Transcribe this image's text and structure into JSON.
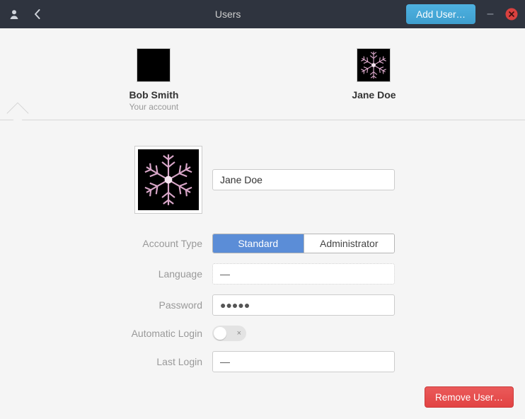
{
  "header": {
    "title": "Users",
    "add_label": "Add User…"
  },
  "users": [
    {
      "name": "Bob Smith",
      "subtitle": "Your account"
    },
    {
      "name": "Jane Doe"
    }
  ],
  "labels": {
    "account_type": "Account Type",
    "language": "Language",
    "password": "Password",
    "automatic_login": "Automatic Login",
    "last_login": "Last Login"
  },
  "detail": {
    "name": "Jane Doe",
    "account_type": {
      "selected": "Standard",
      "options": [
        "Standard",
        "Administrator"
      ]
    },
    "language": "—",
    "password": "●●●●●",
    "automatic_login": false,
    "last_login": "—"
  },
  "footer": {
    "remove_label": "Remove User…"
  },
  "colors": {
    "titlebar": "#2f343f",
    "accent": "#4ba7d5",
    "segment_active": "#5b8dd7",
    "danger": "#e74c4c"
  }
}
